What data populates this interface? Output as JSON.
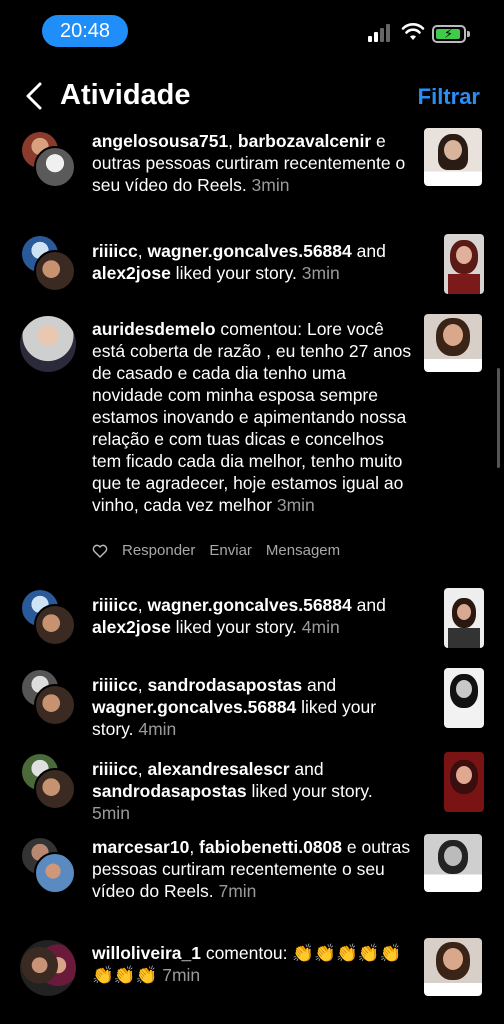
{
  "status_bar": {
    "time": "20:48"
  },
  "header": {
    "title": "Atividade",
    "filter_label": "Filtrar"
  },
  "actions": {
    "reply": "Responder",
    "send": "Enviar",
    "message": "Mensagem"
  },
  "notifications": [
    {
      "user1": "angelosousa751",
      "sep": ", ",
      "user2": "barbozavalcenir",
      "rest": " e outras pessoas curtiram recentemente o seu vídeo do Reels.",
      "time": " 3min"
    },
    {
      "user1": "riiiicc",
      "sep": ", ",
      "user2": "wagner.goncalves.56884",
      "mid": " and ",
      "user3": "alex2jose",
      "rest": " liked your story.",
      "time": " 3min"
    },
    {
      "user1": "auridesdemelo",
      "rest": " comentou: Lore você está coberta de razão , eu tenho 27 anos de casado e cada dia tenho uma novidade com minha esposa sempre estamos inovando e apimentando nossa relação e com tuas dicas e concelhos tem ficado cada dia melhor, tenho muito que te agradecer, hoje estamos igual ao vinho, cada vez melhor",
      "time": " 3min"
    },
    {
      "user1": "riiiicc",
      "sep": ", ",
      "user2": "wagner.goncalves.56884",
      "mid": " and ",
      "user3": "alex2jose",
      "rest": " liked your story.",
      "time": " 4min"
    },
    {
      "user1": "riiiicc",
      "sep": ", ",
      "user2": "sandrodasapostas",
      "mid": " and ",
      "user3": "wagner.goncalves.56884",
      "rest": " liked your story.",
      "time": " 4min"
    },
    {
      "user1": "riiiicc",
      "sep": ", ",
      "user2": "alexandresalescr",
      "mid": " and ",
      "user3": "sandrodasapostas",
      "rest": " liked your story.",
      "time": " 5min"
    },
    {
      "user1": "marcesar10",
      "sep": ", ",
      "user2": "fabiobenetti.0808",
      "rest": " e outras pessoas curtiram recentemente o seu vídeo do Reels.",
      "time": " 7min"
    },
    {
      "user1": "willoliveira_1",
      "rest": " comentou: 👏👏👏👏👏👏👏👏",
      "time": " 7min"
    }
  ]
}
